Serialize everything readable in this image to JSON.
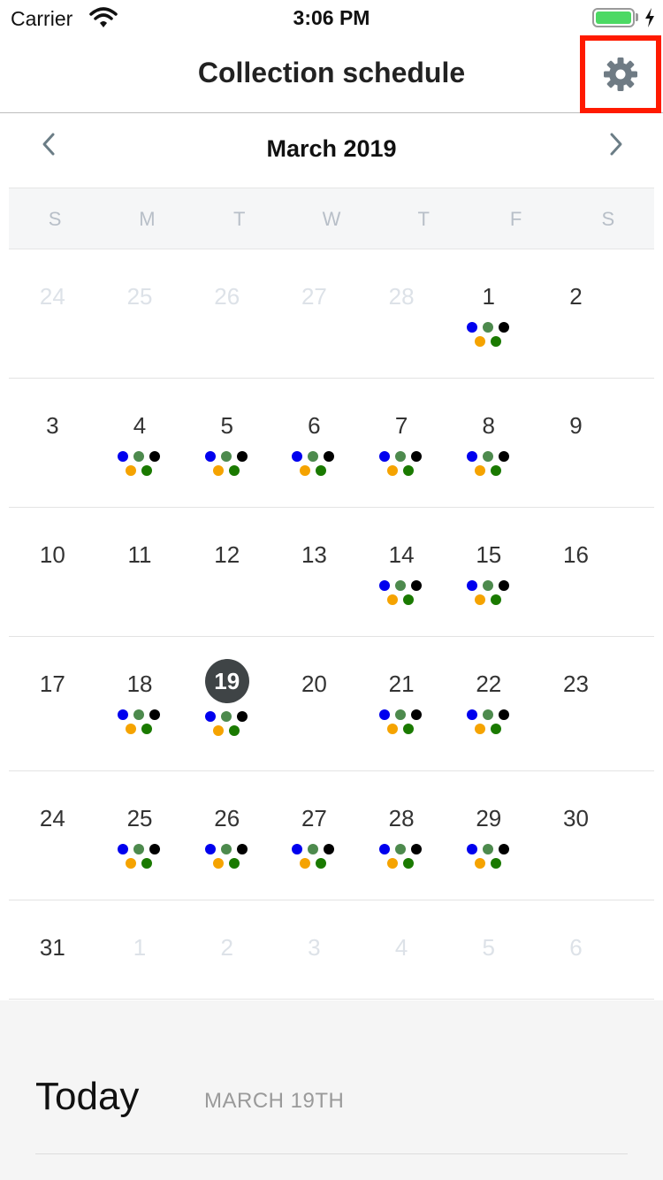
{
  "status_bar": {
    "carrier": "Carrier",
    "time": "3:06 PM",
    "battery_level": 1.0
  },
  "nav": {
    "title": "Collection schedule",
    "settings_icon": "gear-icon"
  },
  "calendar": {
    "month_title": "March 2019",
    "prev_icon": "chevron-left-icon",
    "next_icon": "chevron-right-icon",
    "weekdays": [
      "S",
      "M",
      "T",
      "W",
      "T",
      "F",
      "S"
    ],
    "selected_day": "19",
    "dot_colors": [
      "#0000ee",
      "#4d8a4d",
      "#000000",
      "#f5a300",
      "#1a7a00"
    ],
    "weeks": [
      [
        {
          "day": "24",
          "muted": true,
          "dots": false
        },
        {
          "day": "25",
          "muted": true,
          "dots": false
        },
        {
          "day": "26",
          "muted": true,
          "dots": false
        },
        {
          "day": "27",
          "muted": true,
          "dots": false
        },
        {
          "day": "28",
          "muted": true,
          "dots": false
        },
        {
          "day": "1",
          "muted": false,
          "dots": true
        },
        {
          "day": "2",
          "muted": false,
          "dots": false
        }
      ],
      [
        {
          "day": "3",
          "muted": false,
          "dots": false
        },
        {
          "day": "4",
          "muted": false,
          "dots": true
        },
        {
          "day": "5",
          "muted": false,
          "dots": true
        },
        {
          "day": "6",
          "muted": false,
          "dots": true
        },
        {
          "day": "7",
          "muted": false,
          "dots": true
        },
        {
          "day": "8",
          "muted": false,
          "dots": true
        },
        {
          "day": "9",
          "muted": false,
          "dots": false
        }
      ],
      [
        {
          "day": "10",
          "muted": false,
          "dots": false
        },
        {
          "day": "11",
          "muted": false,
          "dots": false
        },
        {
          "day": "12",
          "muted": false,
          "dots": false
        },
        {
          "day": "13",
          "muted": false,
          "dots": false
        },
        {
          "day": "14",
          "muted": false,
          "dots": true
        },
        {
          "day": "15",
          "muted": false,
          "dots": true
        },
        {
          "day": "16",
          "muted": false,
          "dots": false
        }
      ],
      [
        {
          "day": "17",
          "muted": false,
          "dots": false
        },
        {
          "day": "18",
          "muted": false,
          "dots": true
        },
        {
          "day": "19",
          "muted": false,
          "dots": true,
          "today": true
        },
        {
          "day": "20",
          "muted": false,
          "dots": false
        },
        {
          "day": "21",
          "muted": false,
          "dots": true
        },
        {
          "day": "22",
          "muted": false,
          "dots": true
        },
        {
          "day": "23",
          "muted": false,
          "dots": false
        }
      ],
      [
        {
          "day": "24",
          "muted": false,
          "dots": false
        },
        {
          "day": "25",
          "muted": false,
          "dots": true
        },
        {
          "day": "26",
          "muted": false,
          "dots": true
        },
        {
          "day": "27",
          "muted": false,
          "dots": true
        },
        {
          "day": "28",
          "muted": false,
          "dots": true
        },
        {
          "day": "29",
          "muted": false,
          "dots": true
        },
        {
          "day": "30",
          "muted": false,
          "dots": false
        }
      ],
      [
        {
          "day": "31",
          "muted": false,
          "dots": false
        },
        {
          "day": "1",
          "muted": true,
          "dots": false
        },
        {
          "day": "2",
          "muted": true,
          "dots": false
        },
        {
          "day": "3",
          "muted": true,
          "dots": false
        },
        {
          "day": "4",
          "muted": true,
          "dots": false
        },
        {
          "day": "5",
          "muted": true,
          "dots": false
        },
        {
          "day": "6",
          "muted": true,
          "dots": false
        }
      ]
    ]
  },
  "today_panel": {
    "label": "Today",
    "date": "MARCH 19TH"
  }
}
